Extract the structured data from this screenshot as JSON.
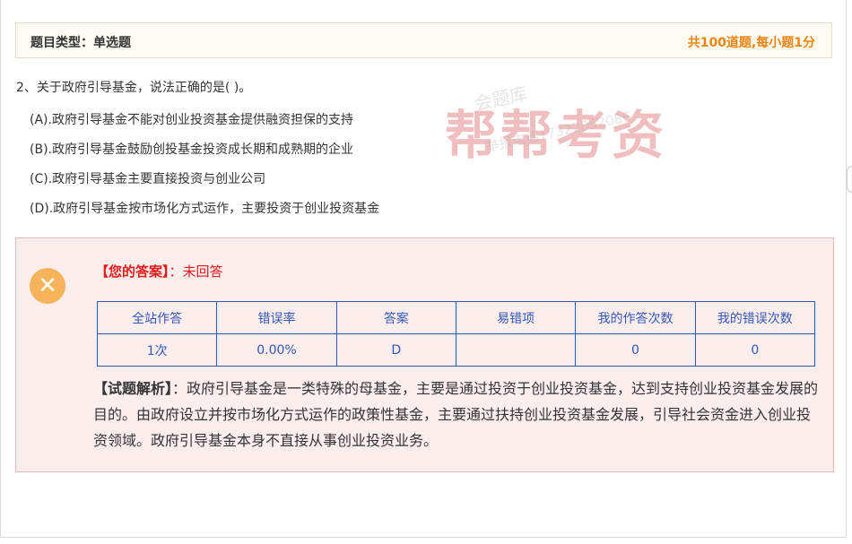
{
  "header": {
    "type_label": "题目类型：单选题",
    "count_text": "共100道题,每小题1分"
  },
  "question": {
    "text": "2、关于政府引导基金，说法正确的是(    )。",
    "options": [
      "(A).政府引导基金不能对创业投资基金提供融资担保的支持",
      "(B).政府引导基金鼓励创投基金投资成长期和成熟期的企业",
      "(C).政府引导基金主要直接投资与创业公司",
      "(D).政府引导基金按市场化方式运作，主要投资于创业投资基金"
    ]
  },
  "watermark": {
    "brand": "帮帮考资",
    "site": "会题库",
    "phone": "举报电话17322052086"
  },
  "result": {
    "icon": "close-icon",
    "answer_label": "【您的答案】",
    "answer_sep": "：",
    "answer_value": "未回答",
    "table": {
      "headers": [
        "全站作答",
        "错误率",
        "答案",
        "易错项",
        "我的作答次数",
        "我的错误次数"
      ],
      "values": [
        "1次",
        "0.00%",
        "D",
        "",
        "0",
        "0"
      ]
    },
    "analysis_label": "【试题解析】",
    "analysis_text": "：政府引导基金是一类特殊的母基金，主要是通过投资于创业投资基金，达到支持创业投资基金发展的目的。由政府设立并按市场化方式运作的政策性基金，主要通过扶持创业投资基金发展，引导社会资金进入创业投资领域。政府引导基金本身不直接从事创业投资业务。"
  },
  "colors": {
    "accent_orange": "#ea8512",
    "error_red": "#e11a1a",
    "table_blue": "#2d56b8",
    "result_bg": "#fdeeee"
  }
}
